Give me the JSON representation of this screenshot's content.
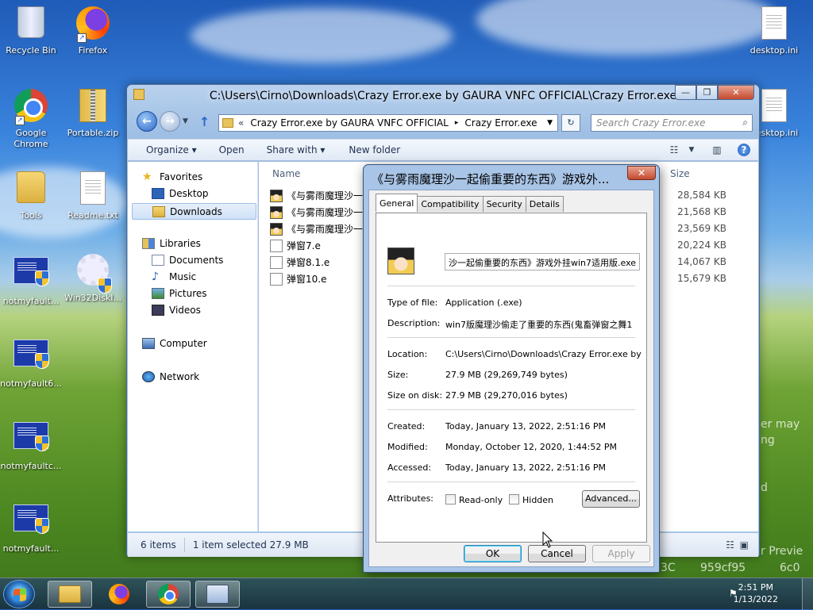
{
  "desktop": {
    "icons": [
      {
        "label": "Recycle Bin",
        "icon": "recycle-bin-icon"
      },
      {
        "label": "Firefox",
        "icon": "firefox-icon"
      },
      {
        "label": "Google Chrome",
        "icon": "chrome-icon"
      },
      {
        "label": "Portable.zip",
        "icon": "zip-icon"
      },
      {
        "label": "Tools",
        "icon": "folder-icon"
      },
      {
        "label": "Readme.txt",
        "icon": "text-file-icon"
      },
      {
        "label": "notmyfault...",
        "icon": "app-icon"
      },
      {
        "label": "Win32DiskI...",
        "icon": "tools-icon"
      },
      {
        "label": "notmyfault6...",
        "icon": "app-icon"
      },
      {
        "label": "notmyfaultc...",
        "icon": "app-icon"
      },
      {
        "label": "notmyfault...",
        "icon": "app-icon"
      },
      {
        "label": "desktop.ini",
        "icon": "settings-file-icon"
      },
      {
        "label": "desktop.ini",
        "icon": "settings-file-icon"
      }
    ],
    "background_fragments": [
      "er may",
      "ng",
      "d",
      "r Previe",
      "3C",
      "959cf95",
      "6c0"
    ]
  },
  "explorer": {
    "title": "C:\\Users\\Cirno\\Downloads\\Crazy Error.exe by GAURA VNFC OFFICIAL\\Crazy Error.exe",
    "address": {
      "chevron": "«",
      "segment1": "Crazy Error.exe by GAURA VNFC OFFICIAL",
      "separator": "▸",
      "segment2": "Crazy Error.exe"
    },
    "search_placeholder": "Search Crazy Error.exe",
    "commands": [
      "Organize ▾",
      "Open",
      "Share with ▾",
      "New folder"
    ],
    "nav": {
      "favorites": "Favorites",
      "desktop": "Desktop",
      "downloads": "Downloads",
      "libraries": "Libraries",
      "documents": "Documents",
      "music": "Music",
      "pictures": "Pictures",
      "videos": "Videos",
      "computer": "Computer",
      "network": "Network"
    },
    "columns": {
      "name": "Name",
      "size": "Size"
    },
    "files": [
      {
        "name": "《与雾雨魔理沙一",
        "size": "28,584 KB",
        "icon": "marisa-exe-icon"
      },
      {
        "name": "《与雾雨魔理沙一",
        "size": "21,568 KB",
        "icon": "marisa-exe-icon"
      },
      {
        "name": "《与雾雨魔理沙一",
        "size": "23,569 KB",
        "icon": "marisa-exe-icon"
      },
      {
        "name": "弹窗7.e",
        "size": "20,224 KB",
        "icon": "file-icon"
      },
      {
        "name": "弹窗8.1.e",
        "size": "14,067 KB",
        "icon": "file-icon"
      },
      {
        "name": "弹窗10.e",
        "size": "15,679 KB",
        "icon": "file-icon"
      }
    ],
    "status": {
      "count": "6 items",
      "selected": "1 item selected  27.9 MB"
    }
  },
  "dialog": {
    "title": "《与雾雨魔理沙一起偷重要的东西》游戏外...",
    "tabs": [
      "General",
      "Compatibility",
      "Security",
      "Details"
    ],
    "file_name": "沙一起偷重要的东西》游戏外挂win7适用版.exe",
    "type_label": "Type of file:",
    "type_value": "Application (.exe)",
    "desc_label": "Description:",
    "desc_value": "win7版魔理沙偷走了重要的东西(鬼畜弹窗之舞1",
    "loc_label": "Location:",
    "loc_value": "C:\\Users\\Cirno\\Downloads\\Crazy Error.exe by GAU",
    "size_label": "Size:",
    "size_value": "27.9 MB (29,269,749 bytes)",
    "disk_label": "Size on disk:",
    "disk_value": "27.9 MB (29,270,016 bytes)",
    "created_label": "Created:",
    "created_value": "Today, January 13, 2022, 2:51:16 PM",
    "modified_label": "Modified:",
    "modified_value": "Monday, October 12, 2020, 1:44:52 PM",
    "accessed_label": "Accessed:",
    "accessed_value": "Today, January 13, 2022, 2:51:16 PM",
    "attr_label": "Attributes:",
    "readonly": "Read-only",
    "hidden": "Hidden",
    "advanced": "Advanced...",
    "ok": "OK",
    "cancel": "Cancel",
    "apply": "Apply"
  },
  "taskbar": {
    "time": "2:51 PM",
    "date": "1/13/2022"
  }
}
